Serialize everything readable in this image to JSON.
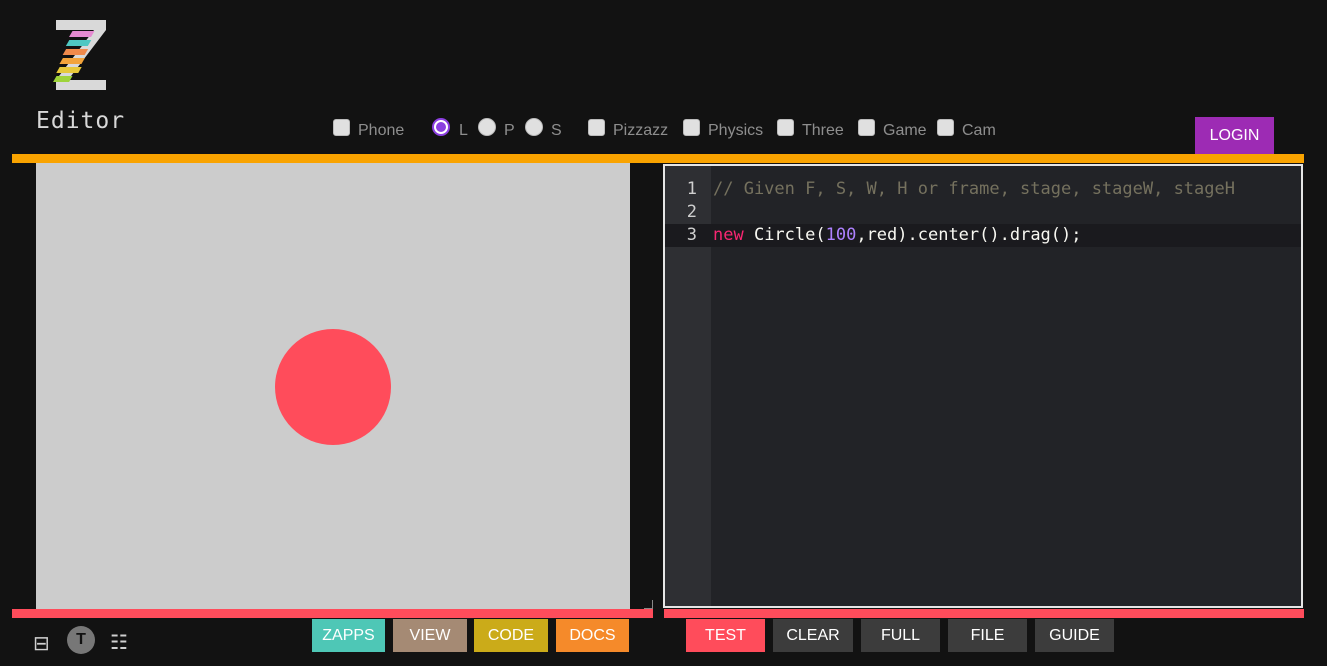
{
  "app": {
    "title": "Editor",
    "logo_colors": [
      "#e58ad1",
      "#4ec7c2",
      "#f08a4b",
      "#f3a33b",
      "#e7c83a",
      "#9fd43a"
    ]
  },
  "options": {
    "phone_label": "Phone",
    "radio_l_label": "L",
    "radio_p_label": "P",
    "radio_s_label": "S",
    "selected_radio": "L",
    "pizzazz_label": "Pizzazz",
    "physics_label": "Physics",
    "three_label": "Three",
    "game_label": "Game",
    "cam_label": "Cam"
  },
  "header": {
    "login_label": "LOGIN"
  },
  "stage": {
    "background": "#cccccc",
    "circle_color": "#ff4c5b"
  },
  "code": {
    "lines": [
      {
        "num": "1",
        "comment": "// Given F, S, W, H or frame, stage, stageW, stageH"
      },
      {
        "num": "2"
      },
      {
        "num": "3",
        "keyword": "new",
        "pre_num": " Circle(",
        "number": "100",
        "post": ",red).center().drag();"
      }
    ]
  },
  "left_buttons": {
    "zapps": "ZAPPS",
    "view": "VIEW",
    "code": "CODE",
    "docs": "DOCS"
  },
  "right_buttons": {
    "test": "TEST",
    "clear": "CLEAR",
    "full": "FULL",
    "file": "FILE",
    "guide": "GUIDE"
  },
  "bottom_icons": {
    "split_icon": "⊟",
    "theme_letter": "T",
    "list_icon": "☷"
  },
  "colors": {
    "accent_top": "#f9a300",
    "accent_bottom": "#ff4c5b",
    "login": "#9d2bb4",
    "zapps": "#4ec7b6",
    "view": "#a58a74",
    "code": "#cbab19",
    "docs": "#f58a2a",
    "test": "#ff4c5b",
    "dark_btn": "#3c3c3c"
  }
}
